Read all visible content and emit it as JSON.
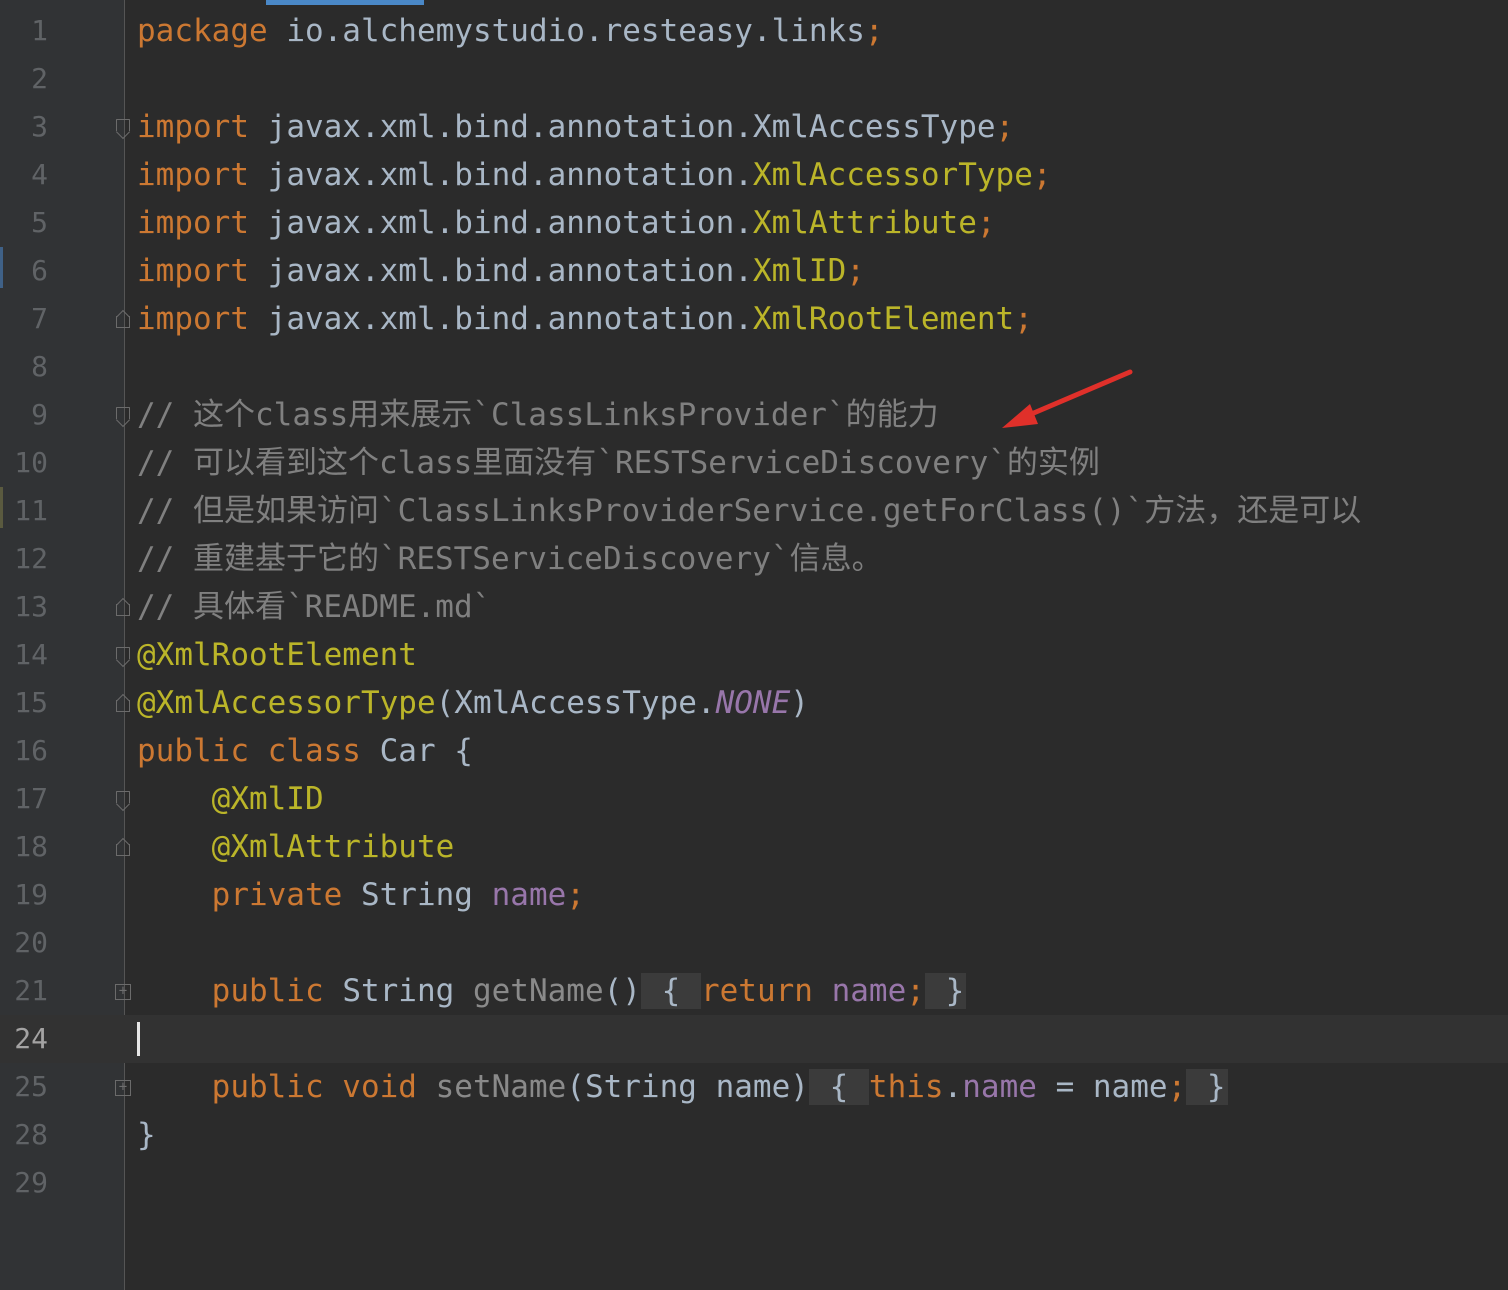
{
  "editor": {
    "lines": [
      {
        "num": "1",
        "fold": "",
        "current": false,
        "tokens": [
          {
            "c": "kw",
            "t": "package "
          },
          {
            "c": "pl",
            "t": "io.alchemystudio.resteasy.links"
          },
          {
            "c": "semi",
            "t": ";"
          }
        ]
      },
      {
        "num": "2",
        "fold": "",
        "current": false,
        "tokens": []
      },
      {
        "num": "3",
        "fold": "top",
        "current": false,
        "tokens": [
          {
            "c": "kw",
            "t": "import "
          },
          {
            "c": "pl",
            "t": "javax.xml.bind.annotation.XmlAccessType"
          },
          {
            "c": "semi",
            "t": ";"
          }
        ]
      },
      {
        "num": "4",
        "fold": "",
        "current": false,
        "tokens": [
          {
            "c": "kw",
            "t": "import "
          },
          {
            "c": "pl",
            "t": "javax.xml.bind.annotation."
          },
          {
            "c": "ann",
            "t": "XmlAccessorType"
          },
          {
            "c": "semi",
            "t": ";"
          }
        ]
      },
      {
        "num": "5",
        "fold": "",
        "current": false,
        "tokens": [
          {
            "c": "kw",
            "t": "import "
          },
          {
            "c": "pl",
            "t": "javax.xml.bind.annotation."
          },
          {
            "c": "ann",
            "t": "XmlAttribute"
          },
          {
            "c": "semi",
            "t": ";"
          }
        ]
      },
      {
        "num": "6",
        "fold": "",
        "current": false,
        "tokens": [
          {
            "c": "kw",
            "t": "import "
          },
          {
            "c": "pl",
            "t": "javax.xml.bind.annotation."
          },
          {
            "c": "ann",
            "t": "XmlID"
          },
          {
            "c": "semi",
            "t": ";"
          }
        ]
      },
      {
        "num": "7",
        "fold": "bottom",
        "current": false,
        "tokens": [
          {
            "c": "kw",
            "t": "import "
          },
          {
            "c": "pl",
            "t": "javax.xml.bind.annotation."
          },
          {
            "c": "ann",
            "t": "XmlRootElement"
          },
          {
            "c": "semi",
            "t": ";"
          }
        ]
      },
      {
        "num": "8",
        "fold": "",
        "current": false,
        "tokens": []
      },
      {
        "num": "9",
        "fold": "top",
        "current": false,
        "tokens": [
          {
            "c": "cm",
            "t": "// 这个class用来展示`ClassLinksProvider`的能力"
          }
        ]
      },
      {
        "num": "10",
        "fold": "",
        "current": false,
        "tokens": [
          {
            "c": "cm",
            "t": "// 可以看到这个class里面没有`RESTServiceDiscovery`的实例"
          }
        ]
      },
      {
        "num": "11",
        "fold": "",
        "current": false,
        "tokens": [
          {
            "c": "cm",
            "t": "// 但是如果访问`ClassLinksProviderService.getForClass()`方法，还是可以"
          }
        ]
      },
      {
        "num": "12",
        "fold": "",
        "current": false,
        "tokens": [
          {
            "c": "cm",
            "t": "// 重建基于它的`RESTServiceDiscovery`信息。"
          }
        ]
      },
      {
        "num": "13",
        "fold": "bottom",
        "current": false,
        "tokens": [
          {
            "c": "cm",
            "t": "// 具体看`README.md`"
          }
        ]
      },
      {
        "num": "14",
        "fold": "top",
        "current": false,
        "tokens": [
          {
            "c": "ann",
            "t": "@XmlRootElement"
          }
        ]
      },
      {
        "num": "15",
        "fold": "bottom",
        "current": false,
        "tokens": [
          {
            "c": "ann",
            "t": "@XmlAccessorType"
          },
          {
            "c": "pl",
            "t": "(XmlAccessType."
          },
          {
            "c": "const",
            "t": "NONE"
          },
          {
            "c": "pl",
            "t": ")"
          }
        ]
      },
      {
        "num": "16",
        "fold": "",
        "current": false,
        "tokens": [
          {
            "c": "kw",
            "t": "public class "
          },
          {
            "c": "pl",
            "t": "Car {"
          }
        ]
      },
      {
        "num": "17",
        "fold": "top",
        "current": false,
        "tokens": [
          {
            "c": "pl",
            "t": "    "
          },
          {
            "c": "ann",
            "t": "@XmlID"
          }
        ]
      },
      {
        "num": "18",
        "fold": "bottom",
        "current": false,
        "tokens": [
          {
            "c": "pl",
            "t": "    "
          },
          {
            "c": "ann",
            "t": "@XmlAttribute"
          }
        ]
      },
      {
        "num": "19",
        "fold": "",
        "current": false,
        "tokens": [
          {
            "c": "pl",
            "t": "    "
          },
          {
            "c": "kw",
            "t": "private "
          },
          {
            "c": "pl",
            "t": "String "
          },
          {
            "c": "fld",
            "t": "name"
          },
          {
            "c": "semi",
            "t": ";"
          }
        ]
      },
      {
        "num": "20",
        "fold": "",
        "current": false,
        "tokens": []
      },
      {
        "num": "21",
        "fold": "box",
        "current": false,
        "tokens": [
          {
            "c": "pl",
            "t": "    "
          },
          {
            "c": "kw",
            "t": "public "
          },
          {
            "c": "pl",
            "t": "String "
          },
          {
            "c": "unused",
            "t": "getName"
          },
          {
            "c": "pl",
            "t": "()"
          },
          {
            "c": "pl box",
            "t": " { "
          },
          {
            "c": "kw",
            "t": "return "
          },
          {
            "c": "fld",
            "t": "name"
          },
          {
            "c": "semi",
            "t": ";"
          },
          {
            "c": "pl box",
            "t": " }"
          }
        ]
      },
      {
        "num": "24",
        "fold": "",
        "current": true,
        "tokens": []
      },
      {
        "num": "25",
        "fold": "box",
        "current": false,
        "tokens": [
          {
            "c": "pl",
            "t": "    "
          },
          {
            "c": "kw",
            "t": "public void "
          },
          {
            "c": "unused",
            "t": "setName"
          },
          {
            "c": "pl",
            "t": "(String name)"
          },
          {
            "c": "pl box",
            "t": " { "
          },
          {
            "c": "kw",
            "t": "this"
          },
          {
            "c": "pl",
            "t": "."
          },
          {
            "c": "fld",
            "t": "name"
          },
          {
            "c": "pl",
            "t": " = name"
          },
          {
            "c": "semi",
            "t": ";"
          },
          {
            "c": "pl box",
            "t": " }"
          }
        ]
      },
      {
        "num": "28",
        "fold": "",
        "current": false,
        "tokens": [
          {
            "c": "pl",
            "t": "}"
          }
        ]
      },
      {
        "num": "29",
        "fold": "",
        "current": false,
        "tokens": []
      }
    ]
  },
  "colors": {
    "background": "#2b2b2b",
    "gutter": "#313335",
    "keyword": "#cc7832",
    "annotation": "#bbb529",
    "comment": "#808080",
    "field": "#9876aa",
    "arrow": "#e0302a"
  },
  "annotation_arrow": {
    "icon": "red-arrow-icon",
    "points_to_line": "10"
  }
}
